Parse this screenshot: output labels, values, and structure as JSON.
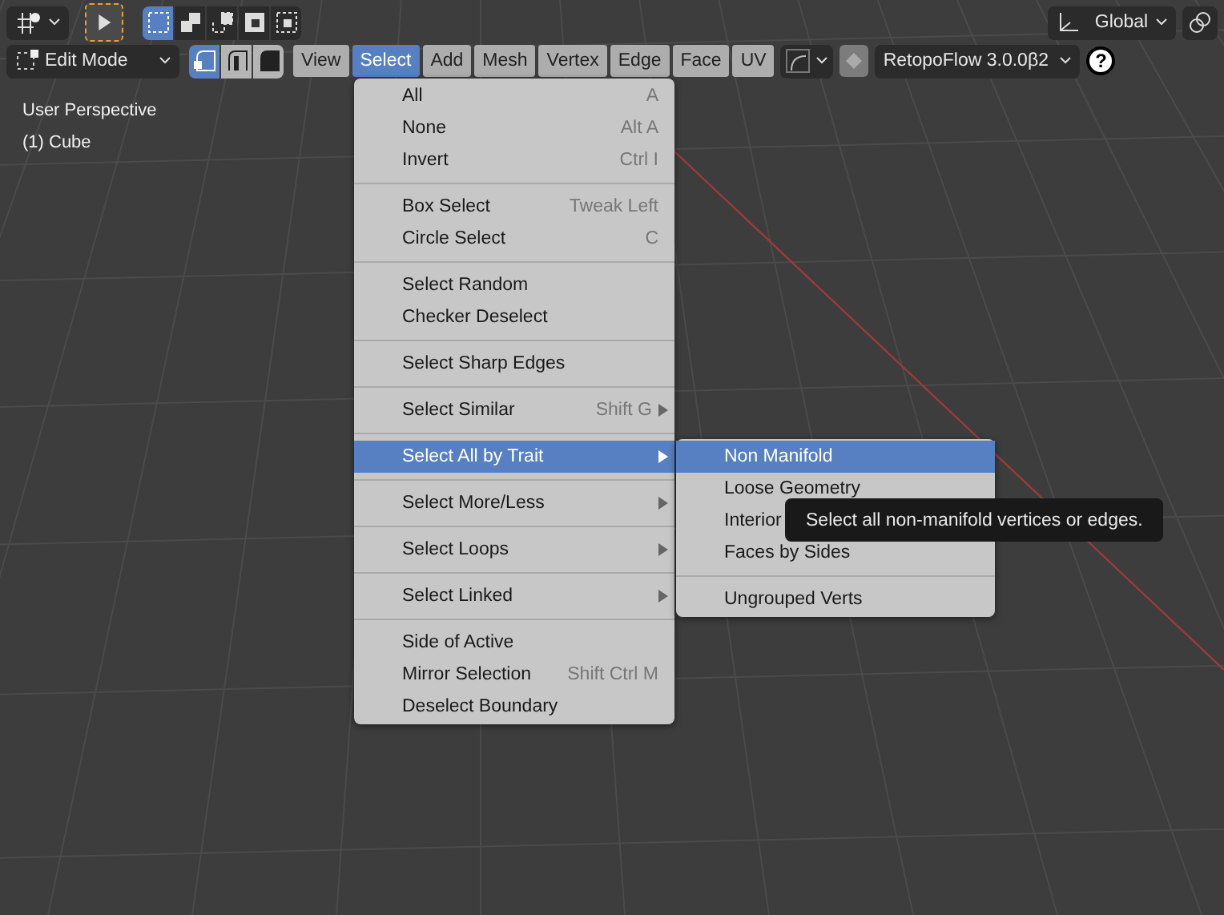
{
  "header_top": {
    "tool_settings": [
      {
        "kind": "gizmo"
      },
      {
        "kind": "tool",
        "selected": true
      }
    ],
    "select_modes": [
      {
        "kind": "new",
        "selected": true
      },
      {
        "kind": "extend",
        "selected": false
      },
      {
        "kind": "subtract",
        "selected": false
      },
      {
        "kind": "invert",
        "selected": false
      },
      {
        "kind": "intersect",
        "selected": false
      }
    ],
    "orientation": {
      "label": "Global"
    }
  },
  "header": {
    "mode": {
      "label": "Edit Mode"
    },
    "element_modes": [
      {
        "kind": "vertex",
        "selected": true
      },
      {
        "kind": "edge",
        "selected": false
      },
      {
        "kind": "face",
        "selected": false
      }
    ],
    "menus": [
      {
        "label": "View",
        "selected": false
      },
      {
        "label": "Select",
        "selected": true
      },
      {
        "label": "Add",
        "selected": false
      },
      {
        "label": "Mesh",
        "selected": false
      },
      {
        "label": "Vertex",
        "selected": false
      },
      {
        "label": "Edge",
        "selected": false
      },
      {
        "label": "Face",
        "selected": false
      },
      {
        "label": "UV",
        "selected": false
      }
    ],
    "addon": {
      "label": "RetopoFlow 3.0.0β2",
      "help": "?"
    }
  },
  "viewport": {
    "lines": [
      "User Perspective",
      "(1) Cube"
    ]
  },
  "select_menu": {
    "groups": [
      [
        {
          "label": "All",
          "shortcut": "A",
          "submenu": false,
          "selected": false
        },
        {
          "label": "None",
          "shortcut": "Alt A",
          "submenu": false,
          "selected": false
        },
        {
          "label": "Invert",
          "shortcut": "Ctrl I",
          "submenu": false,
          "selected": false
        }
      ],
      [
        {
          "label": "Box Select",
          "shortcut": "Tweak Left",
          "submenu": false,
          "selected": false
        },
        {
          "label": "Circle Select",
          "shortcut": "C",
          "submenu": false,
          "selected": false
        }
      ],
      [
        {
          "label": "Select Random",
          "submenu": false,
          "selected": false
        },
        {
          "label": "Checker Deselect",
          "submenu": false,
          "selected": false
        }
      ],
      [
        {
          "label": "Select Sharp Edges",
          "submenu": false,
          "selected": false
        }
      ],
      [
        {
          "label": "Select Similar",
          "shortcut": "Shift G",
          "submenu": true,
          "selected": false
        }
      ],
      [
        {
          "label": "Select All by Trait",
          "submenu": true,
          "selected": true
        }
      ],
      [
        {
          "label": "Select More/Less",
          "submenu": true,
          "selected": false
        }
      ],
      [
        {
          "label": "Select Loops",
          "submenu": true,
          "selected": false
        }
      ],
      [
        {
          "label": "Select Linked",
          "submenu": true,
          "selected": false
        }
      ],
      [
        {
          "label": "Side of Active",
          "submenu": false,
          "selected": false
        },
        {
          "label": "Mirror Selection",
          "shortcut": "Shift Ctrl M",
          "submenu": false,
          "selected": false
        },
        {
          "label": "Deselect Boundary",
          "submenu": false,
          "selected": false
        }
      ]
    ]
  },
  "submenu": {
    "groups": [
      [
        {
          "label": "Non Manifold",
          "selected": true
        },
        {
          "label": "Loose Geometry",
          "selected": false
        },
        {
          "label": "Interior",
          "selected": false
        },
        {
          "label": "Faces by Sides",
          "selected": false
        }
      ],
      [
        {
          "label": "Ungrouped Verts",
          "selected": false
        }
      ]
    ]
  },
  "tooltip": {
    "text": "Select all non-manifold vertices or edges."
  }
}
